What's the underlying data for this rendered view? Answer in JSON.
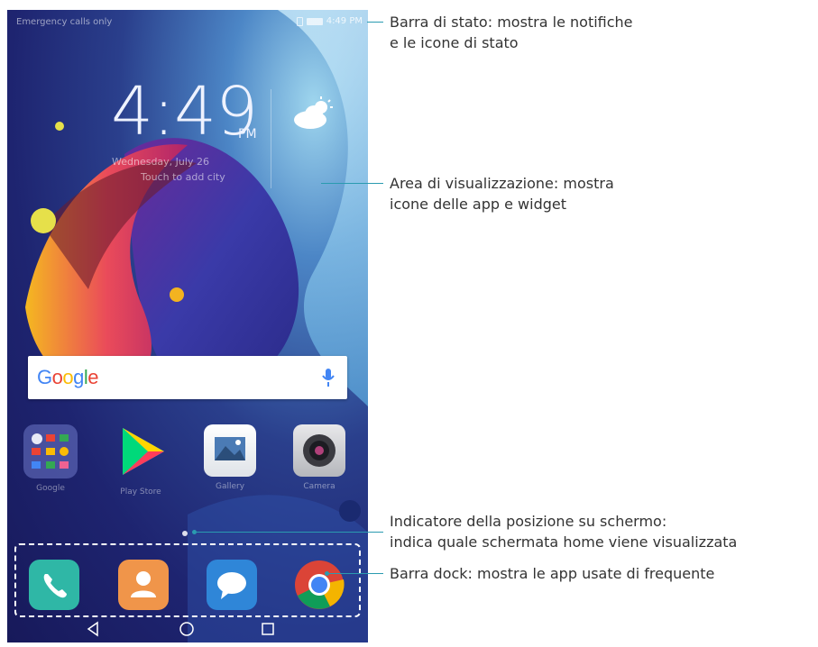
{
  "status_bar": {
    "left_text": "Emergency calls only",
    "time": "4:49 PM"
  },
  "clock_widget": {
    "time": "4:49",
    "ampm": "PM",
    "date": "Wednesday, July 26",
    "city_hint": "Touch to add city",
    "weather_icon": "partly-cloudy-icon"
  },
  "search": {
    "logo": "Google",
    "logo_colors": [
      "#4285F4",
      "#EA4335",
      "#FBBC05",
      "#4285F4",
      "#34A853",
      "#EA4335"
    ],
    "mic_icon": "mic-icon"
  },
  "apps": [
    {
      "label": "Google",
      "icon": "google-folder-icon"
    },
    {
      "label": "Play Store",
      "icon": "play-store-icon"
    },
    {
      "label": "Gallery",
      "icon": "gallery-icon"
    },
    {
      "label": "Camera",
      "icon": "camera-icon"
    }
  ],
  "dock": [
    {
      "icon": "phone-icon",
      "color": "#2fb7a6"
    },
    {
      "icon": "contacts-icon",
      "color": "#f0954a"
    },
    {
      "icon": "messaging-icon",
      "color": "#2f86d8"
    },
    {
      "icon": "chrome-icon",
      "color": "#db4437"
    }
  ],
  "nav": [
    "back-icon",
    "home-icon",
    "recents-icon"
  ],
  "callouts": {
    "status_bar": [
      "Barra di stato: mostra le notifiche",
      "e le icone di stato"
    ],
    "display_area": [
      "Area di visualizzazione: mostra",
      "icone delle app e widget"
    ],
    "position_indicator": [
      "Indicatore della posizione su schermo:",
      "indica quale schermata home viene visualizzata"
    ],
    "dock_bar": [
      "Barra dock: mostra le app usate di frequente"
    ]
  },
  "colors": {
    "callout_line": "#2a9bb0",
    "callout_text": "#333333"
  }
}
